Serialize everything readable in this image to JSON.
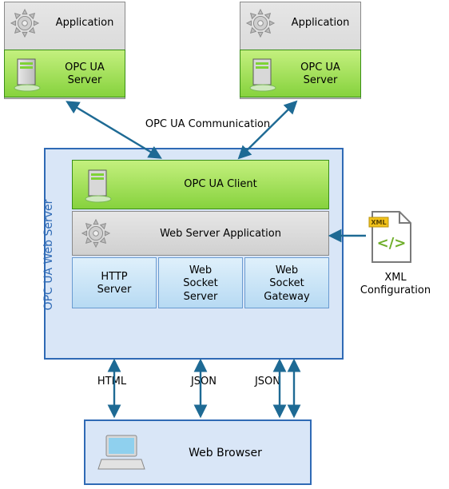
{
  "top_nodes": [
    {
      "app_label": "Application",
      "server_label": "OPC UA\nServer"
    },
    {
      "app_label": "Application",
      "server_label": "OPC UA\nServer"
    }
  ],
  "comm_label": "OPC UA Communication",
  "web_server": {
    "title": "OPC UA Web Server",
    "client_label": "OPC UA Client",
    "app_label": "Web Server Application",
    "protocols": [
      {
        "name": "HTTP\nServer",
        "wire_label": "HTML"
      },
      {
        "name": "Web\nSocket\nServer",
        "wire_label": "JSON"
      },
      {
        "name": "Web\nSocket\nGateway",
        "wire_label": "JSON"
      }
    ]
  },
  "xml": {
    "badge": "XML",
    "label": "XML Configuration"
  },
  "browser_label": "Web Browser",
  "colors": {
    "arrow": "#1e6a94",
    "green_light": "#c4f07e",
    "green_dark": "#86d23d",
    "blue_border": "#2f6ab5"
  }
}
